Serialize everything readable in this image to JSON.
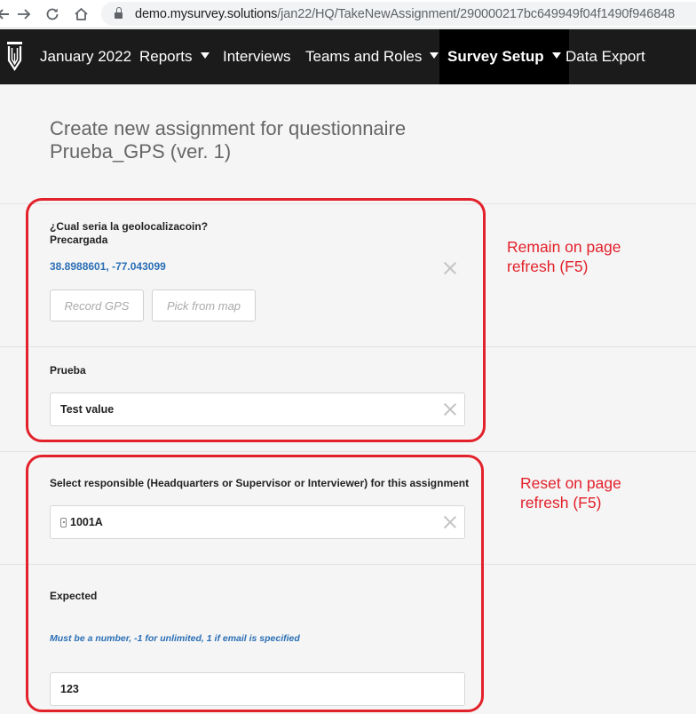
{
  "browser": {
    "url_host": "demo.mysurvey.solutions",
    "url_path": "/jan22/HQ/TakeNewAssignment/290000217bc649949f04f1490f946848",
    "icons": [
      "back-arrow-icon",
      "forward-arrow-icon",
      "reload-icon",
      "home-icon",
      "lock-icon"
    ]
  },
  "nav": {
    "items": [
      {
        "label": "January 2022",
        "dropdown": false
      },
      {
        "label": "Reports",
        "dropdown": true
      },
      {
        "label": "Interviews",
        "dropdown": false
      },
      {
        "label": "Teams and Roles",
        "dropdown": true
      },
      {
        "label": "Survey Setup",
        "dropdown": true,
        "active": true
      },
      {
        "label": "Data Export",
        "dropdown": false
      }
    ]
  },
  "page": {
    "title": "Create new assignment for questionnaire Prueba_GPS (ver. 1)"
  },
  "form": {
    "gps_question": {
      "label": "¿Cual seria la geolocalizacoin?",
      "sublabel": "Precargada",
      "value": "38.8988601, -77.043099",
      "record_label": "Record GPS",
      "pick_label": "Pick from map"
    },
    "prueba": {
      "label": "Prueba",
      "value": "Test value"
    },
    "responsible": {
      "label": "Select responsible (Headquarters or Supervisor or Interviewer) for this assignment",
      "value": "1001A"
    },
    "expected": {
      "label": "Expected",
      "hint": "Must be a number, -1 for unlimited, 1 if email is specified",
      "value": "123"
    }
  },
  "annotations": {
    "remain": "Remain on page\nrefresh (F5)",
    "reset": "Reset on page\nrefresh (F5)",
    "color": "#e3212b"
  },
  "colors": {
    "nav_bg": "#1b1b1b",
    "link_blue": "#2a6fb5",
    "page_bg": "#f5f5f5"
  }
}
